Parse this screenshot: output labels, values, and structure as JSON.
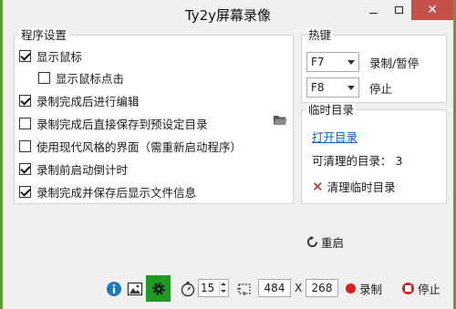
{
  "window": {
    "title": "Ty2y屏幕录像",
    "close_symbol": "✕"
  },
  "program_settings": {
    "legend": "程序设置",
    "options": [
      {
        "label": "显示鼠标",
        "checked": true
      },
      {
        "label": "显示鼠标点击",
        "checked": false
      },
      {
        "label": "录制完成后进行编辑",
        "checked": true
      },
      {
        "label": "录制完成后直接保存到预设定目录",
        "checked": false
      },
      {
        "label": "使用现代风格的界面（需重新启动程序）",
        "checked": false
      },
      {
        "label": "录制前启动倒计时",
        "checked": true
      },
      {
        "label": "录制完成并保存后显示文件信息",
        "checked": true
      }
    ]
  },
  "hotkeys": {
    "legend": "热键",
    "record_key": "F7",
    "record_label": "录制/暂停",
    "stop_key": "F8",
    "stop_label": "停止"
  },
  "temp_dir": {
    "legend": "临时目录",
    "open_link": "打开目录",
    "count_label": "可清理的目录：",
    "count_value": "3",
    "clear_button": "清理临时目录"
  },
  "restart_label": "重启",
  "bottom": {
    "countdown_value": "15",
    "width_value": "484",
    "x_label": "X",
    "height_value": "268",
    "record_label": "录制",
    "stop_label": "停止"
  },
  "colors": {
    "accent_green": "#1f9a22",
    "record_red": "#e01b1b",
    "link_blue": "#0563c1",
    "close_red": "#c7514a"
  },
  "icons": {
    "info": "info-icon",
    "image": "image-icon",
    "settings": "gear-icon",
    "timer": "stopwatch-icon",
    "region": "region-select-icon",
    "folder": "folder-icon",
    "restart": "restart-icon"
  }
}
